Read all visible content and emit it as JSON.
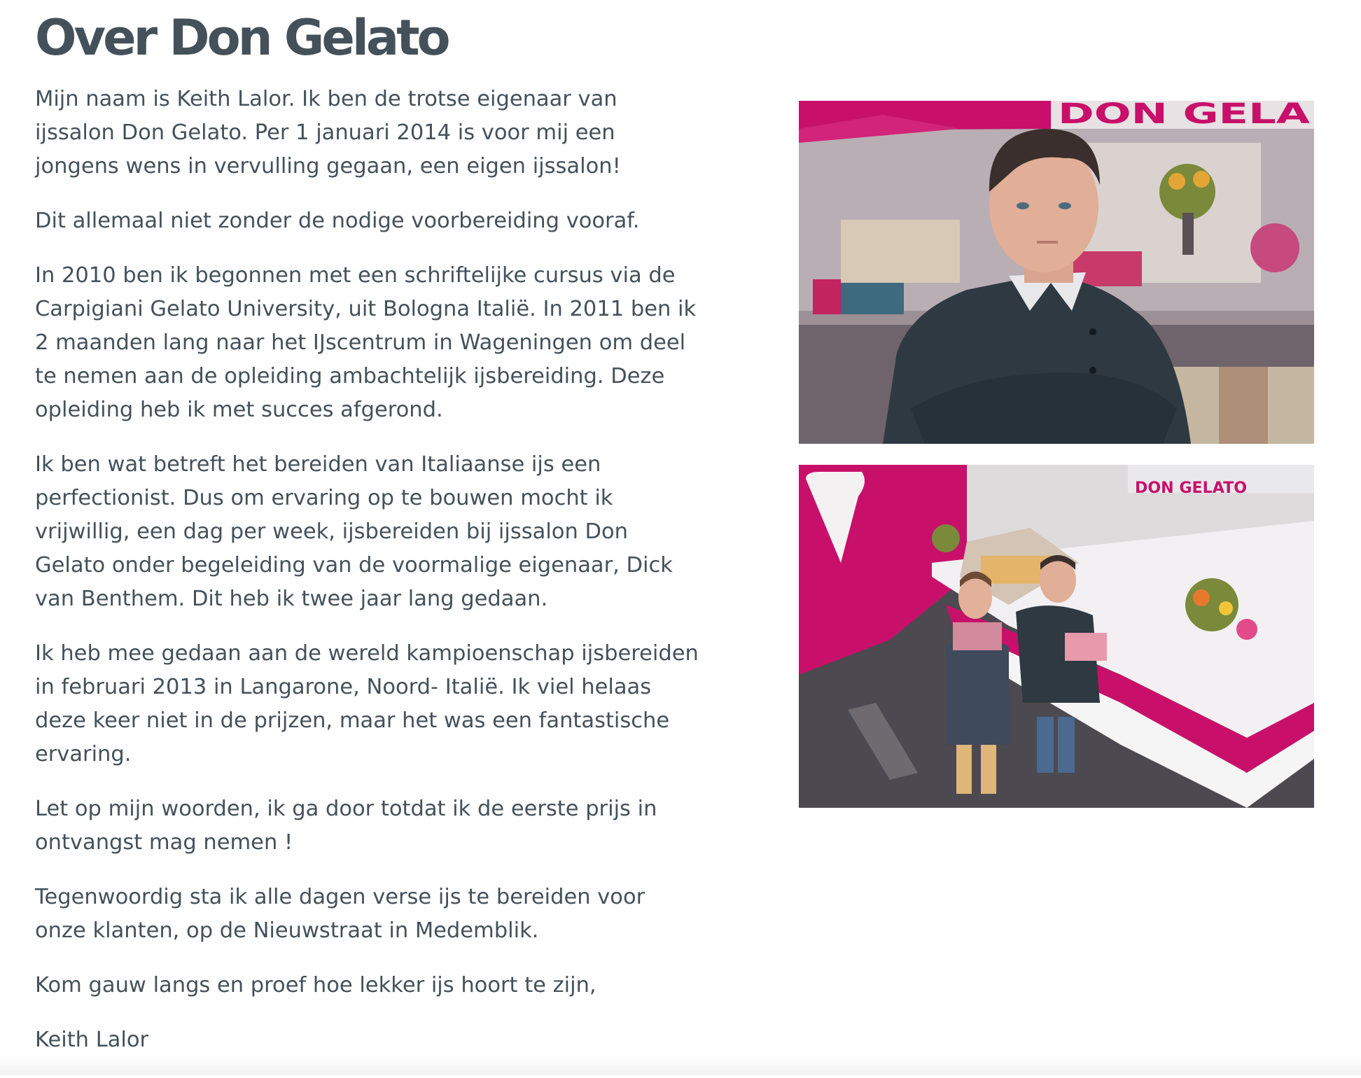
{
  "page": {
    "title": "Over Don Gelato"
  },
  "paragraphs": [
    "Mijn naam is Keith Lalor. Ik ben de trotse eigenaar van ijssalon Don Gelato. Per 1 januari 2014 is voor mij een jongens wens in vervulling gegaan, een eigen ijssalon!",
    "Dit allemaal niet zonder de nodige voorbereiding vooraf.",
    "In 2010 ben ik begonnen met een schriftelijke cursus via de Carpigiani Gelato University, uit Bologna Italië. In 2011 ben ik 2 maanden lang naar het IJscentrum in Wageningen om deel te nemen aan de opleiding ambachtelijk ijsbereiding. Deze opleiding heb ik met succes afgerond.",
    "Ik ben wat betreft het bereiden van Italiaanse ijs een perfectionist. Dus om ervaring op te bouwen mocht ik vrijwillig, een dag per week, ijsbereiden bij ijssalon Don Gelato onder begeleiding van de voormalige eigenaar, Dick van Benthem. Dit heb ik twee jaar lang gedaan.",
    "Ik heb mee gedaan aan de wereld kampioenschap ijsbereiden in februari 2013 in Langarone, Noord- Italië. Ik viel helaas deze keer niet in de prijzen, maar het was een fantastische ervaring.",
    "Let op mijn woorden, ik ga door totdat ik de eerste prijs in ontvangst mag nemen !",
    "Tegenwoordig sta ik alle dagen verse ijs te bereiden voor onze klanten, op de Nieuwstraat in Medemblik.",
    "Kom gauw langs en proef hoe lekker ijs hoort te zijn,",
    "Keith Lalor"
  ],
  "photos": {
    "portrait_sign": "DON GELA",
    "shop_sign": "DON GELATO"
  },
  "colors": {
    "text": "#44515a",
    "brand_pink": "#c8106a"
  }
}
